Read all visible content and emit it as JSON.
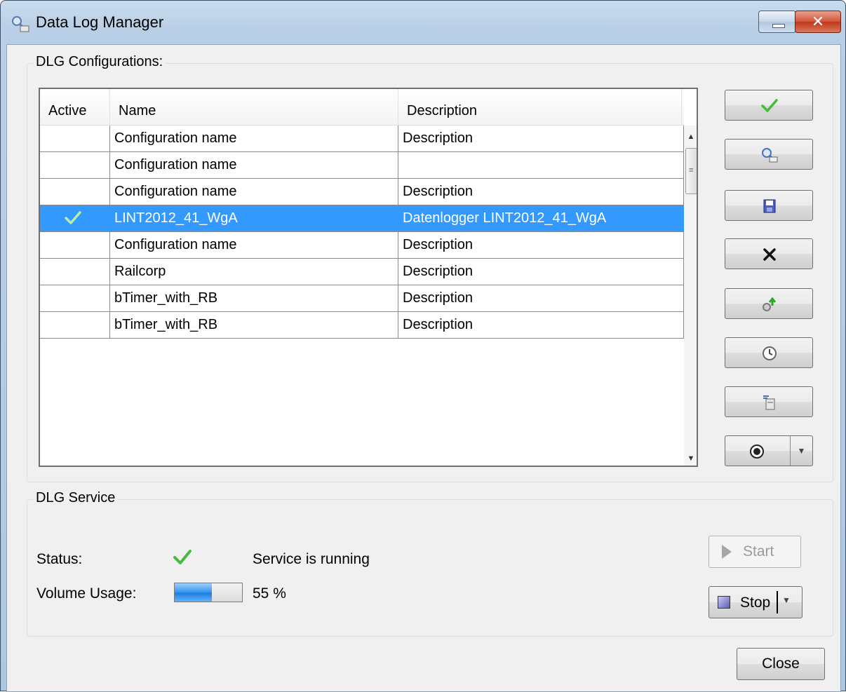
{
  "window": {
    "title": "Data Log Manager"
  },
  "configurations": {
    "group_label": "DLG Configurations:",
    "columns": [
      "Active",
      "Name",
      "Description"
    ],
    "rows": [
      {
        "active": false,
        "name": "Configuration name",
        "description": "Description",
        "selected": false
      },
      {
        "active": false,
        "name": "Configuration name",
        "description": "",
        "selected": false
      },
      {
        "active": false,
        "name": "Configuration name",
        "description": "Description",
        "selected": false
      },
      {
        "active": true,
        "name": "LINT2012_41_WgA",
        "description": "Datenlogger LINT2012_41_WgA",
        "selected": true
      },
      {
        "active": false,
        "name": "Configuration name",
        "description": "Description",
        "selected": false
      },
      {
        "active": false,
        "name": "Railcorp",
        "description": "Description",
        "selected": false
      },
      {
        "active": false,
        "name": "bTimer_with_RB",
        "description": "Description",
        "selected": false
      },
      {
        "active": false,
        "name": "bTimer_with_RB",
        "description": "Description",
        "selected": false
      }
    ],
    "side_buttons": [
      {
        "icon": "checkmark-icon"
      },
      {
        "icon": "data-log-config-icon"
      },
      {
        "icon": "save-icon"
      },
      {
        "icon": "delete-x-icon"
      },
      {
        "icon": "gear-upload-icon"
      },
      {
        "icon": "clock-icon"
      },
      {
        "icon": "database-export-icon"
      },
      {
        "icon": "info-icon"
      }
    ]
  },
  "service": {
    "group_label": "DLG Service",
    "status_label": "Status:",
    "status_text": "Service is running",
    "usage_label": "Volume Usage:",
    "usage_text": "55 %",
    "usage_fraction": 0.55,
    "start_label": "Start",
    "stop_label": "Stop"
  },
  "footer": {
    "close_label": "Close"
  },
  "colors": {
    "selection": "#3399ff",
    "check": "#44bb3c",
    "titlebar": "#b9cfe6"
  }
}
